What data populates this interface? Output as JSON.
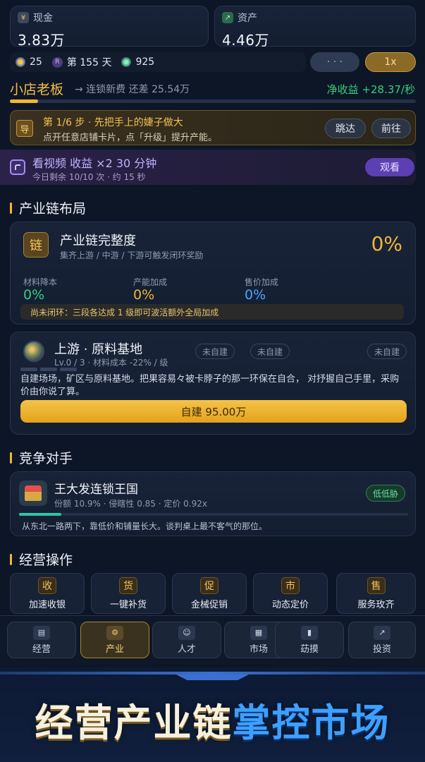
{
  "stats": {
    "cash_label": "现金",
    "cash_value": "3.83万",
    "assets_label": "资产",
    "assets_value": "4.46万"
  },
  "status_row": {
    "coins": "25",
    "day_text": "第 155 天",
    "gems": "925",
    "more_label": "· · ·",
    "speed_label": "1x"
  },
  "rank": {
    "title": "小店老板",
    "next_text": "→ 连锁新费 还差 25.54万",
    "net_income": "净收益 +28.37/秒",
    "progress": 0.07
  },
  "guide": {
    "badge": "导",
    "title": "第 1/6 步 · 先把手上的婕子做大",
    "desc": "点开任意店铺卡片，点「升级」提升产能。",
    "skip_label": "跳达",
    "go_label": "前往"
  },
  "ad": {
    "title": "看视频 收益 ×2 30 分钟",
    "sub": "今日剩余 10/10 次 · 约 15 秒",
    "watch_label": "观看"
  },
  "chain_section": {
    "title": "产业链布局",
    "card": {
      "badge": "链",
      "title": "产业链完整度",
      "sub": "集齐上游 / 中游 / 下游可触发闭环奖励",
      "percent": "0%",
      "metrics": [
        {
          "label": "材料降本",
          "value": "0%"
        },
        {
          "label": "产能加成",
          "value": "0%"
        },
        {
          "label": "售价加成",
          "value": "0%"
        }
      ],
      "notice": "尚未闭环：三段各达成 1 级即可波活额外全局加成"
    },
    "upstream": {
      "title": "上游 · 原料基地",
      "meta": "Lv.0 / 3 · 材料成本 -22% / 级",
      "tags": [
        "未自建",
        "未自建",
        "未自建"
      ],
      "desc": "自建场场，矿区与原料基地。把果容易々被卡脖子的那一环保在自合， 对抒握自己手里，采购价由你说了算。",
      "build_label": "自建 95.00万"
    }
  },
  "competitor_section": {
    "title": "竞争对手",
    "card": {
      "name": "王大发连锁王国",
      "stats": "份额 10.9% · 侵瞎性 0.85 · 定价 0.92x",
      "threat": "低低胁",
      "desc": "从东北一路两下，靠低价和铺量长大。谈判桌上最不客气的那位。",
      "share": 0.109
    }
  },
  "ops_section": {
    "title": "经营操作",
    "items": [
      {
        "icon": "收",
        "label": "加速收银"
      },
      {
        "icon": "货",
        "label": "一键补货"
      },
      {
        "icon": "促",
        "label": "金械促销"
      },
      {
        "icon": "市",
        "label": "动态定价"
      },
      {
        "icon": "售",
        "label": "服务玫齐"
      }
    ]
  },
  "nav": {
    "items": [
      {
        "label": "经营"
      },
      {
        "label": "产业"
      },
      {
        "label": "人才"
      },
      {
        "label": "市场"
      },
      {
        "label": "苭摸"
      },
      {
        "label": "投资"
      }
    ]
  },
  "banner": {
    "part1": "经营产业链",
    "part2": "掌控市场"
  },
  "colors": {
    "accent_gold": "#f2b632",
    "accent_green": "#35d07f",
    "accent_blue": "#4aa6ff",
    "accent_purple": "#8b5cf6"
  }
}
